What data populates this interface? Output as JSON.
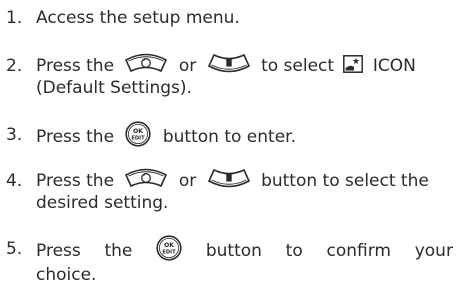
{
  "steps": [
    {
      "number": "1.",
      "text": "Access the setup menu."
    },
    {
      "number": "2.",
      "pre": "Press the",
      "or": "or",
      "mid": "to select",
      "post": "ICON",
      "line2": "(Default Settings).",
      "icons": [
        "rotate-up-button-icon",
        "trash-down-button-icon",
        "default-settings-icon"
      ]
    },
    {
      "number": "3.",
      "pre": "Press the",
      "post": "button to enter.",
      "icons": [
        "ok-edit-button-icon"
      ]
    },
    {
      "number": "4.",
      "pre": "Press the",
      "or": "or",
      "post": "button to select the",
      "line2": "desired setting.",
      "icons": [
        "rotate-up-button-icon",
        "trash-down-button-icon"
      ]
    },
    {
      "number": "5.",
      "words": [
        "Press",
        "the",
        "button",
        "to",
        "confirm",
        "your"
      ],
      "line2": "choice.",
      "icons": [
        "ok-edit-button-icon"
      ]
    }
  ],
  "ok_button_label": {
    "top": "OK",
    "bottom": "EDIT"
  }
}
